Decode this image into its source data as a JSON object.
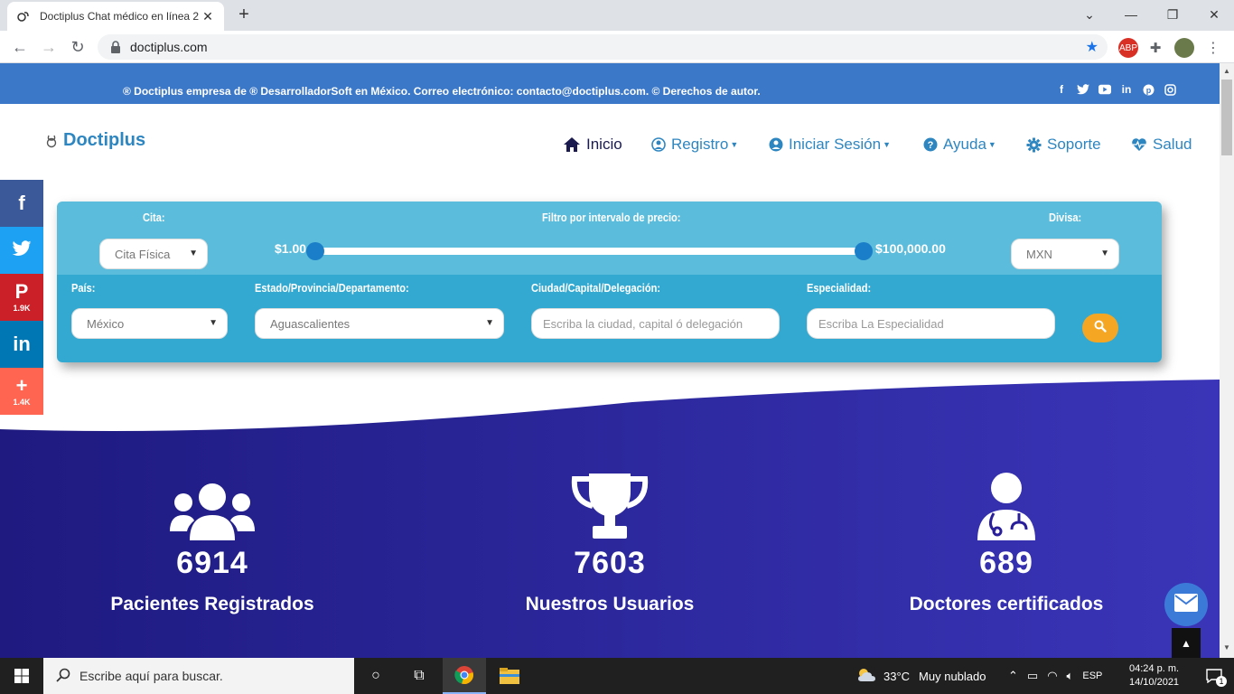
{
  "browser": {
    "tab_title": "Doctiplus Chat médico en línea 2",
    "close_tab": "✕",
    "new_tab": "+",
    "url": "doctiplus.com"
  },
  "topbar": {
    "text": "® Doctiplus empresa de ® DesarrolladorSoft en México. Correo electrónico: contacto@doctiplus.com. © Derechos de autor."
  },
  "logo": {
    "text": "Doctiplus"
  },
  "menu": {
    "inicio": "Inicio",
    "registro": "Registro",
    "iniciar_sesion": "Iniciar Sesión",
    "ayuda": "Ayuda",
    "soporte": "Soporte",
    "salud": "Salud"
  },
  "share": {
    "pinterest_count": "1.9K",
    "more_count": "1.4K"
  },
  "filter": {
    "cita_label": "Cita:",
    "cita_value": "Cita Física",
    "price_label": "Filtro por intervalo de precio:",
    "price_min": "$1.00",
    "price_max": "$100,000.00",
    "divisa_label": "Divisa:",
    "divisa_value": "MXN",
    "pais_label": "País:",
    "pais_value": "México",
    "estado_label": "Estado/Provincia/Departamento:",
    "estado_value": "Aguascalientes",
    "ciudad_label": "Ciudad/Capital/Delegación:",
    "ciudad_placeholder": "Escriba la ciudad, capital ó delegación",
    "especialidad_label": "Especialidad:",
    "especialidad_placeholder": "Escriba La Especialidad"
  },
  "stats": {
    "pacientes_num": "6914",
    "pacientes_label": "Pacientes Registrados",
    "usuarios_num": "7603",
    "usuarios_label": "Nuestros Usuarios",
    "doctores_num": "689",
    "doctores_label": "Doctores certificados"
  },
  "taskbar": {
    "search_placeholder": "Escribe aquí para buscar.",
    "weather": "33°C",
    "weather_desc": "Muy nublado",
    "lang": "ESP",
    "time": "04:24 p. m.",
    "date": "14/10/2021",
    "notif_count": "1"
  },
  "colors": {
    "topstrip": "#3c78c8",
    "panel_top": "#5bbcdc",
    "panel_bottom": "#33a9d1",
    "stats_bg": "#2a1f9a",
    "accent_orange": "#f5a623"
  }
}
